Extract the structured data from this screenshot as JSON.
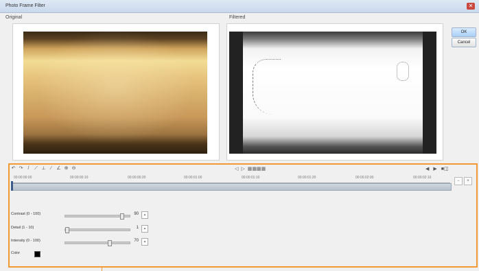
{
  "window": {
    "title": "Photo Frame Filter",
    "close_label": "✕"
  },
  "panes": {
    "original_label": "Original",
    "filtered_label": "Filtered"
  },
  "buttons": {
    "ok": "OK",
    "cancel": "Cancel"
  },
  "toolbar": {
    "tool_icons": [
      "undo-icon",
      "redo-icon",
      "pencil-icon",
      "brush-icon",
      "eraser-icon",
      "pen-icon",
      "pen2-icon",
      "zoom-icon",
      "zoom2-icon"
    ]
  },
  "transport": {
    "labels": [
      "◁",
      "▷",
      "▦▦▦▦"
    ]
  },
  "right_tools": {
    "labels": [
      "◀",
      "▶",
      "■◫"
    ]
  },
  "timeline": {
    "ticks": [
      "00:00:00:00",
      "00:00:00:10",
      "00:00:00:20",
      "00:00:01:00",
      "00:00:01:10",
      "00:00:01:20",
      "00:00:02:00",
      "00:00:02:10"
    ],
    "progress": 0.0
  },
  "params": [
    {
      "label": "Contrast (0 - 100)",
      "value": "90",
      "position": 0.9
    },
    {
      "label": "Detail (1 - 10)",
      "value": "1",
      "position": 0.0
    },
    {
      "label": "Intensity (0 - 100)",
      "value": "70",
      "position": 0.7
    }
  ],
  "color": {
    "label": "Color",
    "value": "#000000"
  },
  "accent": "#f19a34"
}
